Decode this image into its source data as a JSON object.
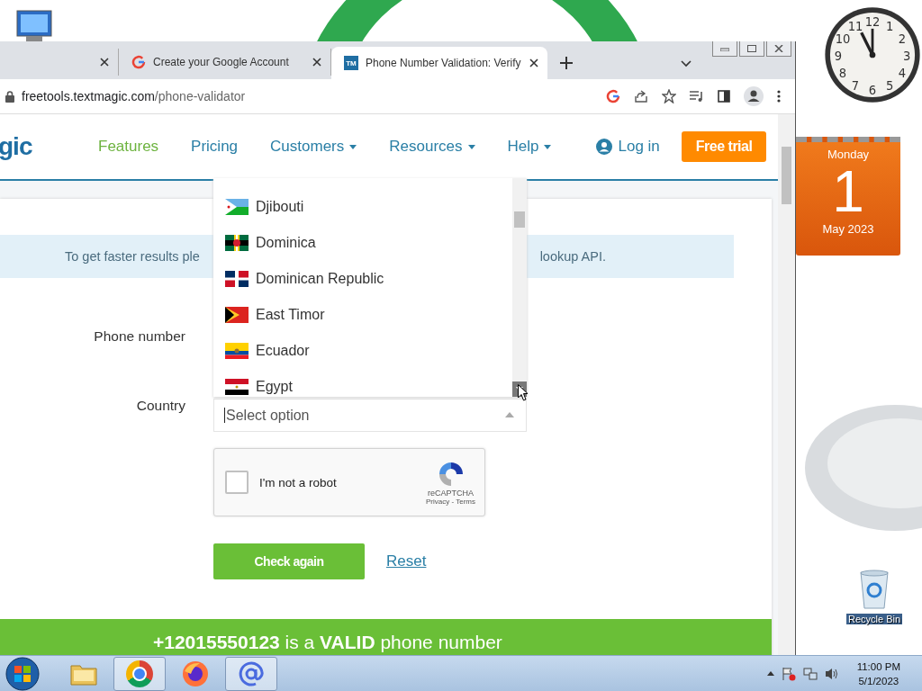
{
  "desktop": {
    "recycle_bin": {
      "label": "Recycle Bin"
    },
    "clock": {
      "dial_numbers": [
        "11",
        "12",
        "1",
        "10",
        "2",
        "9",
        "3",
        "8",
        "4",
        "7",
        "5",
        "6"
      ]
    },
    "calendar": {
      "weekday": "Monday",
      "day": "1",
      "month_year": "May 2023"
    }
  },
  "browser": {
    "tabs": [
      {
        "selected": false
      },
      {
        "title": "Create your Google Account",
        "kind": "google",
        "selected": false
      },
      {
        "title": "Phone Number Validation: Verify",
        "kind": "textmagic",
        "favicon_text": "TM",
        "selected": true
      }
    ],
    "address": {
      "domain": "freetools.textmagic.com",
      "path": "/phone-validator"
    }
  },
  "page": {
    "logo_text": "gic",
    "nav": [
      {
        "label": "Features",
        "kind": "link",
        "selected": true
      },
      {
        "label": "Pricing",
        "kind": "link",
        "selected": false
      },
      {
        "label": "Customers",
        "kind": "menu",
        "selected": false
      },
      {
        "label": "Resources",
        "kind": "menu",
        "selected": false
      },
      {
        "label": "Help",
        "kind": "menu",
        "selected": false
      }
    ],
    "login": "Log in",
    "cta": "Free trial",
    "banner": {
      "text_start": "To get faster results ple",
      "text_end": "lookup API."
    },
    "phone_label": "Phone number",
    "country_label": "Country",
    "country_select": {
      "placeholder": "Select option",
      "expanded": true,
      "options": [
        {
          "name": "Djibouti",
          "kind": "djibouti"
        },
        {
          "name": "Dominica",
          "kind": "dominica"
        },
        {
          "name": "Dominican Republic",
          "kind": "dominican"
        },
        {
          "name": "East Timor",
          "kind": "timor"
        },
        {
          "name": "Ecuador",
          "kind": "ecuador"
        },
        {
          "name": "Egypt",
          "kind": "egypt"
        }
      ]
    },
    "captcha": {
      "label": "I'm not a robot",
      "checked": false,
      "brand": "reCAPTCHA",
      "privacy": "Privacy",
      "separator": "-",
      "terms": "Terms"
    },
    "check_button": "Check again",
    "reset_link": "Reset",
    "result": "**+12015550123** is a **VALID** phone number"
  },
  "taskbar": {
    "apps": [
      {
        "kind": "folder",
        "selected": false
      },
      {
        "kind": "chrome",
        "selected": true
      },
      {
        "kind": "firefox",
        "selected": false
      },
      {
        "kind": "at",
        "selected": true
      }
    ],
    "time": "11:00 PM",
    "date": "5/1/2023"
  }
}
